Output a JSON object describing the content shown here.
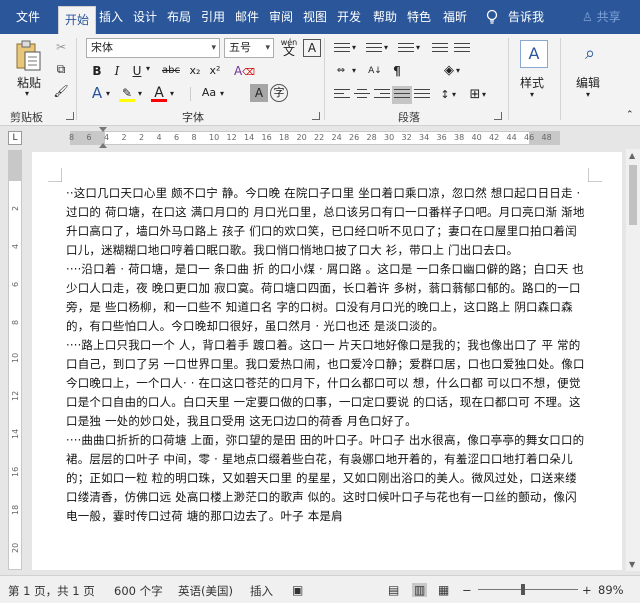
{
  "tabs": [
    {
      "label": "文件",
      "active": false
    },
    {
      "label": "开始",
      "active": true
    },
    {
      "label": "插入",
      "active": false
    },
    {
      "label": "设计",
      "active": false
    },
    {
      "label": "布局",
      "active": false
    },
    {
      "label": "引用",
      "active": false
    },
    {
      "label": "邮件",
      "active": false
    },
    {
      "label": "审阅",
      "active": false
    },
    {
      "label": "视图",
      "active": false
    },
    {
      "label": "开发",
      "active": false
    },
    {
      "label": "帮助",
      "active": false
    },
    {
      "label": "特色",
      "active": false
    },
    {
      "label": "福昕",
      "active": false
    }
  ],
  "tell_me": "告诉我",
  "share": "共享",
  "clipboard": {
    "paste_label": "粘贴",
    "group_label": "剪贴板"
  },
  "font": {
    "name": "宋体",
    "size": "五号",
    "wen_label": "wén",
    "group_label": "字体",
    "text_A": "A",
    "bold": "B",
    "italic": "I",
    "underline": "U",
    "strike": "abc",
    "sub": "x₂",
    "sup": "x²",
    "clear": "A",
    "highlight_color": "#ffff00",
    "font_color": "#ff0000"
  },
  "paragraph": {
    "group_label": "段落"
  },
  "styles": {
    "label": "样式"
  },
  "editing": {
    "label": "编辑"
  },
  "ruler": {
    "tab_selector": "L",
    "numbers": [
      "8",
      "6",
      "4",
      "2",
      "2",
      "4",
      "6",
      "8",
      "10",
      "12",
      "14",
      "16",
      "18",
      "20",
      "22",
      "24",
      "26",
      "28",
      "30",
      "32",
      "34",
      "36",
      "38",
      "40",
      "42",
      "44",
      "46",
      "48"
    ],
    "vertical_numbers": [
      "2",
      "4",
      "6",
      "8",
      "10",
      "12",
      "14",
      "16",
      "18",
      "20"
    ]
  },
  "document": {
    "paragraphs": [
      "··这口几口天口心里 颇不口宁 静。今口晚 在院口子口里 坐口着口乘口凉，忽口然 想口起口日日走 · 过口的 荷口塘，在口这 满口月口的 月口光口里，总口该另口有口一口番样子口吧。月口亮口渐 渐地 升口高口了，墙口外马口路上 孩子 们口的欢口笑，已口经口听不见口了；妻口在口屋里口拍口着闰口儿，迷糊糊口地口哼着口眠口歌。我口悄口悄地口披了口大 衫，带口上 门出口去口。",
      "····沿口着 · 荷口塘，是口一 条口曲 折 的口小煤 · 屑口路 。这口是 一口条口幽口僻的路；白口天 也少口人口走，夜 晚口更口加 寂口寞。荷口塘口四面，长口着许 多树，蓊口蓊郁口郁的。路口的一口旁，是 些口杨柳，和一口些不 知道口名 字的口树。口没有月口光的晚口上，这口路上 阴口森口森的，有口些怕口人。今口晚却口很好，虽口然月 · 光口也还 是淡口淡的。",
      "····路上口只我口一个 人，背口着手 踱口着。这口一 片天口地好像口是我的；我也像出口了 平 常的口自己，到口了另 一口世界口里。我口爱热口闹，也口爱冷口静；爱群口居，口也口爱独口处。像口今口晚口上，一个口人· · 在口这口苍茫的口月下，什口么都口可以 想，什么口都 可以口不想，便觉口是个口自由的口人。白口天里 一定要口做的口事，一口定口要说 的口话，现在口都口可 不理。这口是独 一处的妙口处，我且口受用 这无口边口的荷香 月色口好了。",
      "····曲曲口折折的口荷塘 上面，弥口望的是田 田的叶口子。叶口子 出水很高，像口亭亭的舞女口口的裙。层层的口叶子 中间，零 · 星地点口缀着些白花，有袅娜口地开着的，有羞涩口口地打着口朵儿的；正如口一粒 粒的明口珠，又如碧天口里 的星星，又如口刚出浴口的美人。微风过处，口送来缕口缕清香，仿佛口远 处高口楼上渺茫口的歌声 似的。这时口候叶口子与花也有一口丝的颤动，像闪电一般，霎时传口过荷 塘的那口边去了。叶子 本是肩"
    ]
  },
  "status": {
    "page": "第 1 页，共 1 页",
    "words": "600 个字",
    "language": "英语(美国)",
    "mode": "插入",
    "zoom": "89%",
    "zoom_level": 0.45
  }
}
